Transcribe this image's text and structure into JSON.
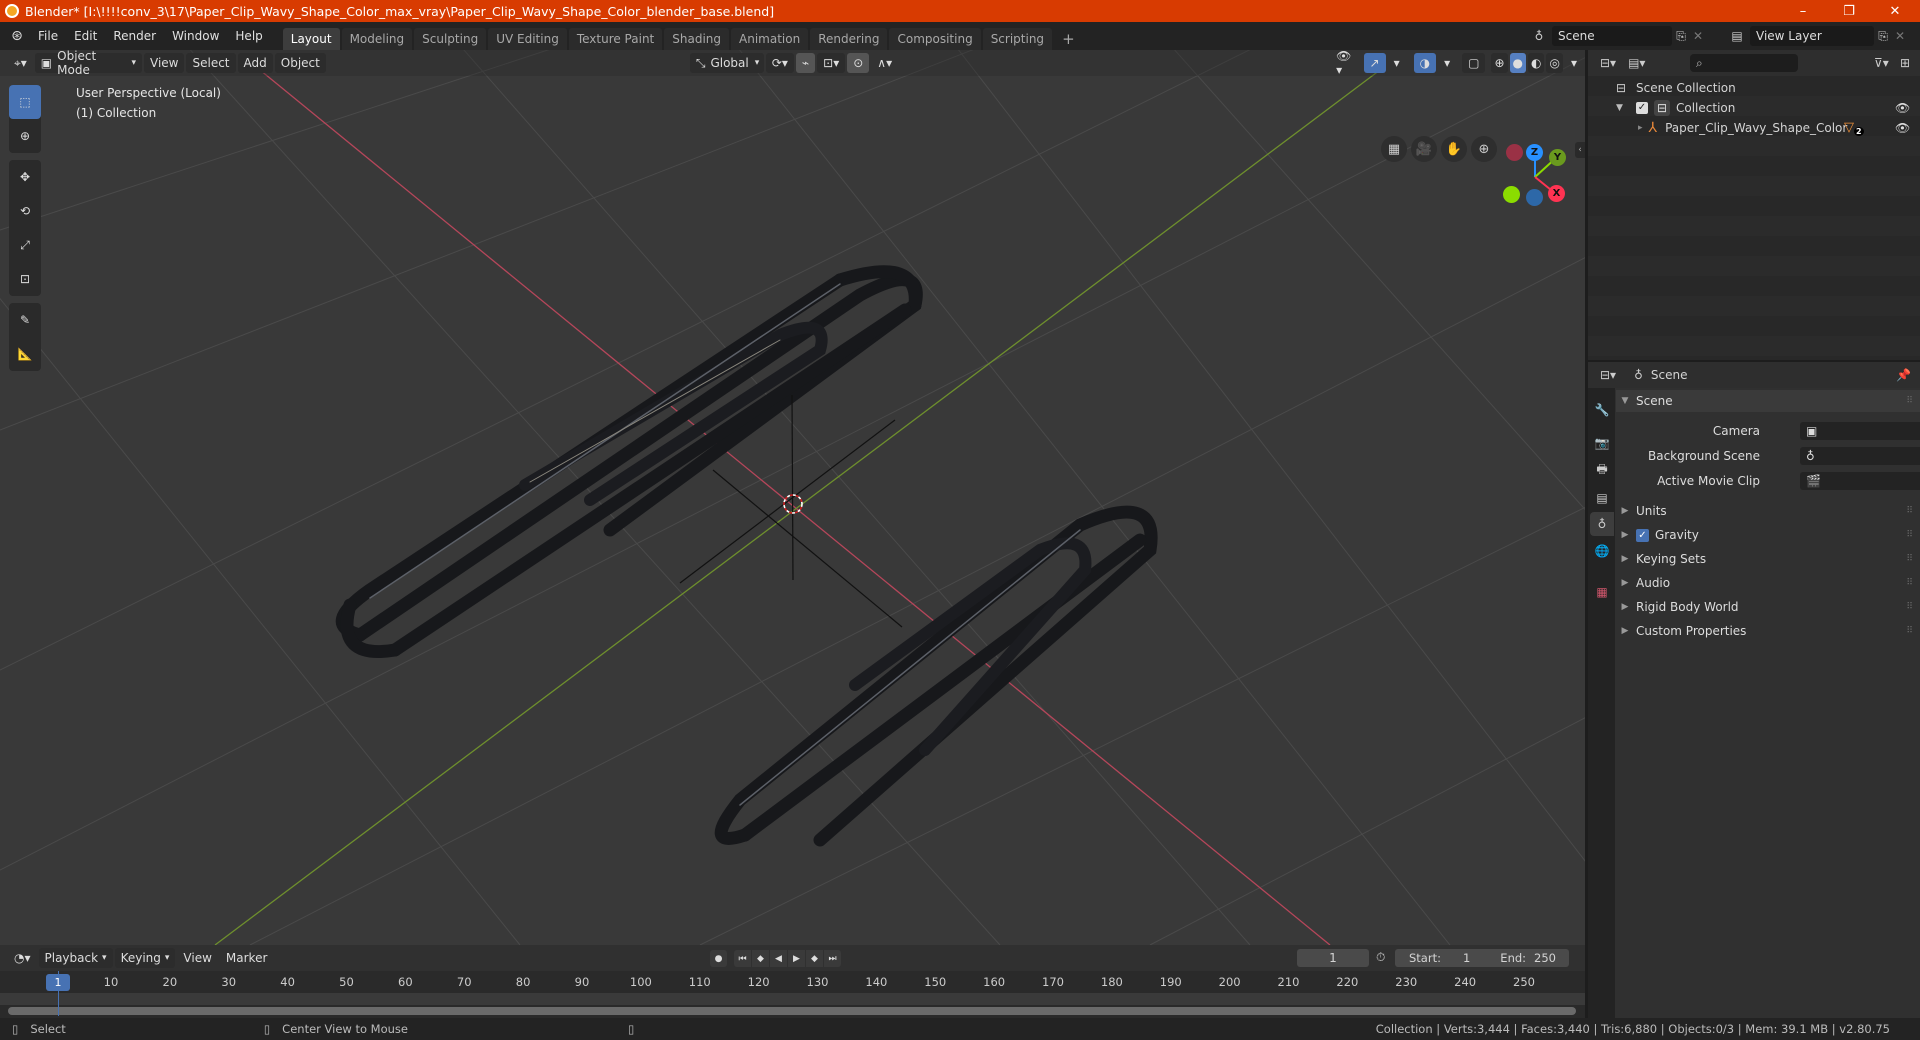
{
  "window": {
    "title": "Blender* [I:\\!!!!conv_3\\17\\Paper_Clip_Wavy_Shape_Color_max_vray\\Paper_Clip_Wavy_Shape_Color_blender_base.blend]",
    "controls": {
      "minimize": "–",
      "maximize": "❐",
      "close": "✕"
    }
  },
  "menu": {
    "items": [
      "File",
      "Edit",
      "Render",
      "Window",
      "Help"
    ]
  },
  "workspaces": {
    "tabs": [
      "Layout",
      "Modeling",
      "Sculpting",
      "UV Editing",
      "Texture Paint",
      "Shading",
      "Animation",
      "Rendering",
      "Compositing",
      "Scripting"
    ],
    "active": "Layout",
    "add_label": "+"
  },
  "scene_selector": {
    "value": "Scene"
  },
  "view_layer_selector": {
    "value": "View Layer"
  },
  "viewport": {
    "header": {
      "mode": "Object Mode",
      "menus": [
        "View",
        "Select",
        "Add",
        "Object"
      ],
      "orientation": "Global"
    },
    "overlay_text": {
      "line1": "User Perspective (Local)",
      "line2": "(1) Collection"
    },
    "tools": [
      "select-box",
      "cursor",
      "move",
      "rotate",
      "scale",
      "transform",
      "annotate",
      "measure"
    ],
    "nav_buttons": [
      "grid-view",
      "camera",
      "pan",
      "zoom"
    ],
    "gizmo": {
      "x": "X",
      "y": "Y",
      "z": "Z"
    },
    "colors": {
      "x_axis": "#ff3352",
      "y_axis": "#8bdc00",
      "z_axis": "#2890ff",
      "bg": "#393939"
    }
  },
  "outliner": {
    "search_placeholder": "",
    "rows": [
      {
        "label": "Scene Collection",
        "icon": "collection-icon"
      },
      {
        "label": "Collection",
        "icon": "collection-icon",
        "checked": true
      },
      {
        "label": "Paper_Clip_Wavy_Shape_Color",
        "icon": "empty-axes-icon",
        "badge": "2"
      }
    ]
  },
  "properties": {
    "context": "Scene",
    "section": "Scene",
    "fields": [
      {
        "label": "Camera",
        "value": ""
      },
      {
        "label": "Background Scene",
        "value": ""
      },
      {
        "label": "Active Movie Clip",
        "value": ""
      }
    ],
    "panels": [
      {
        "label": "Units"
      },
      {
        "label": "Gravity",
        "checkbox": true
      },
      {
        "label": "Keying Sets"
      },
      {
        "label": "Audio"
      },
      {
        "label": "Rigid Body World"
      },
      {
        "label": "Custom Properties"
      }
    ]
  },
  "timeline": {
    "menus": [
      "Playback",
      "Keying",
      "View",
      "Marker"
    ],
    "current_frame": "1",
    "start_label": "Start:",
    "start": "1",
    "end_label": "End:",
    "end": "250",
    "ticks": [
      "10",
      "20",
      "30",
      "40",
      "50",
      "60",
      "70",
      "80",
      "90",
      "100",
      "110",
      "120",
      "130",
      "140",
      "150",
      "160",
      "170",
      "180",
      "190",
      "200",
      "210",
      "220",
      "230",
      "240",
      "250"
    ],
    "playhead": "1"
  },
  "statusbar": {
    "left_action": "Select",
    "middle_action": "Center View to Mouse",
    "stats": "Collection | Verts:3,444 | Faces:3,440 | Tris:6,880 | Objects:0/3 | Mem: 39.1 MB | v2.80.75"
  }
}
